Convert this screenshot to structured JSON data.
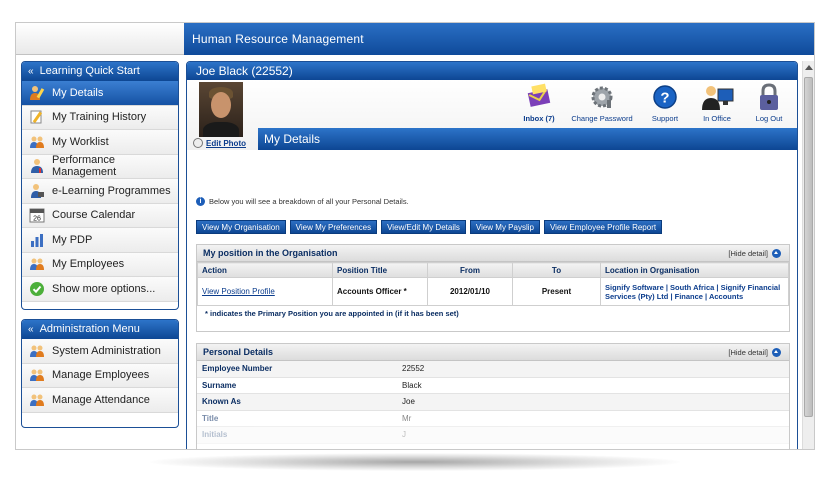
{
  "app": {
    "title": "Human Resource Management"
  },
  "quick_start": {
    "title": "Learning Quick Start",
    "items": [
      {
        "label": "My Details",
        "icon": "person-pencil-icon",
        "active": true
      },
      {
        "label": "My Training History",
        "icon": "pencil-icon",
        "active": false
      },
      {
        "label": "My Worklist",
        "icon": "people-icon",
        "active": false
      },
      {
        "label": "Performance Management",
        "icon": "person-chart-icon",
        "active": false
      },
      {
        "label": "e-Learning Programmes",
        "icon": "person-computer-icon",
        "active": false
      },
      {
        "label": "Course Calendar",
        "icon": "calendar-icon",
        "active": false
      },
      {
        "label": "My PDP",
        "icon": "bar-chart-icon",
        "active": false
      },
      {
        "label": "My Employees",
        "icon": "people-icon",
        "active": false
      },
      {
        "label": "Show more options...",
        "icon": "check-circle-icon",
        "active": false
      }
    ]
  },
  "admin_menu": {
    "title": "Administration Menu",
    "items": [
      {
        "label": "System Administration",
        "icon": "people-icon"
      },
      {
        "label": "Manage Employees",
        "icon": "people-icon"
      },
      {
        "label": "Manage Attendance",
        "icon": "people-icon"
      }
    ]
  },
  "employee": {
    "header": "Joe Black (22552)",
    "edit_photo": "Edit Photo",
    "page_title": "My Details"
  },
  "toolbar": {
    "inbox": "Inbox (7)",
    "change_password": "Change Password",
    "support": "Support",
    "in_office": "In Office",
    "log_out": "Log Out"
  },
  "intro_text": "Below you will see a breakdown of all your Personal Details.",
  "buttons": {
    "view_org": "View My Organisation",
    "view_prefs": "View My Preferences",
    "edit_details": "View/Edit My Details",
    "view_payslip": "View My Payslip",
    "profile_report": "View Employee Profile Report"
  },
  "position_section": {
    "title": "My position in the Organisation",
    "hide_label": "[Hide detail]",
    "columns": {
      "action": "Action",
      "title": "Position Title",
      "from": "From",
      "to": "To",
      "location": "Location in Organisation"
    },
    "row": {
      "action": "View Position Profile",
      "title": "Accounts Officer *",
      "from": "2012/01/10",
      "to": "Present",
      "location": "Signify Software | South Africa | Signify Financial Services (Pty) Ltd | Finance | Accounts"
    },
    "note": "* indicates the Primary Position you are appointed in (if it has been set)"
  },
  "personal_section": {
    "title": "Personal Details",
    "hide_label": "[Hide detail]",
    "rows": [
      {
        "label": "Employee Number",
        "value": "22552"
      },
      {
        "label": "Surname",
        "value": "Black"
      },
      {
        "label": "Known As",
        "value": "Joe"
      },
      {
        "label": "Title",
        "value": "Mr"
      },
      {
        "label": "Initials",
        "value": "J"
      }
    ]
  },
  "colors": {
    "brand_blue": "#0d4693",
    "header_gradient_top": "#2d74c9",
    "link_blue": "#0b3c8c"
  }
}
